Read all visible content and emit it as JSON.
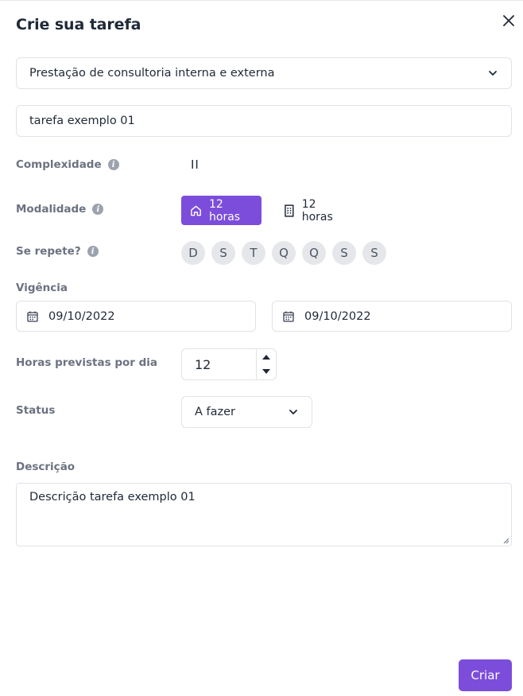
{
  "modal": {
    "title": "Crie sua tarefa"
  },
  "project_select": {
    "value": "Prestação de consultoria interna e externa"
  },
  "task_name": {
    "value": "tarefa exemplo 01"
  },
  "complexity": {
    "label": "Complexidade",
    "value": "II"
  },
  "modality": {
    "label": "Modalidade",
    "options": [
      {
        "label": "12 horas",
        "icon": "home-icon",
        "selected": true
      },
      {
        "label": "12 horas",
        "icon": "building-icon",
        "selected": false
      }
    ]
  },
  "repeat": {
    "label": "Se repete?",
    "days": [
      "D",
      "S",
      "T",
      "Q",
      "Q",
      "S",
      "S"
    ]
  },
  "validity": {
    "label": "Vigência",
    "start": "09/10/2022",
    "end": "09/10/2022"
  },
  "hours_per_day": {
    "label": "Horas previstas por dia",
    "value": "12"
  },
  "status": {
    "label": "Status",
    "value": "A fazer"
  },
  "description": {
    "label": "Descrição",
    "value": "Descrição tarefa exemplo 01"
  },
  "actions": {
    "create_label": "Criar"
  },
  "colors": {
    "accent": "#7c4ddb",
    "label": "#6b7280",
    "border": "#dfe3e8",
    "day_bg": "#e5e7eb"
  }
}
